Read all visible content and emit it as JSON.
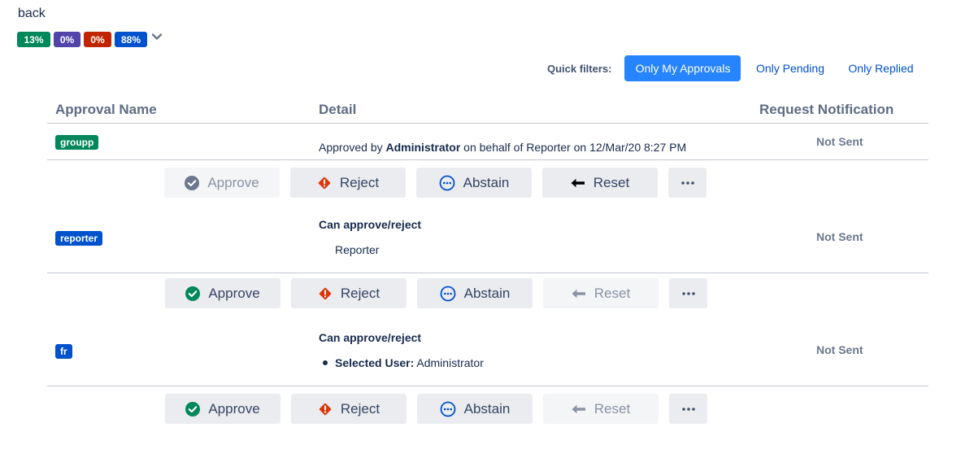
{
  "nav": {
    "back_label": "back"
  },
  "progress": {
    "badges": [
      {
        "label": "13%",
        "color": "#00875a"
      },
      {
        "label": "0%",
        "color": "#5243aa"
      },
      {
        "label": "0%",
        "color": "#bf2600"
      },
      {
        "label": "88%",
        "color": "#0052cc"
      }
    ],
    "expand_icon": "chevron-down-icon"
  },
  "quick_filters": {
    "label": "Quick filters:",
    "options": [
      {
        "label": "Only My Approvals",
        "active": true
      },
      {
        "label": "Only Pending",
        "active": false
      },
      {
        "label": "Only Replied",
        "active": false
      }
    ]
  },
  "table": {
    "headers": [
      "Approval Name",
      "Detail",
      "Request Notification"
    ],
    "rows": [
      {
        "name": "groupp",
        "name_color": "#00875a",
        "detail_prefix": "Approved by ",
        "detail_user": "Administrator",
        "detail_suffix": " on behalf of Reporter on 12/Mar/20 8:27 PM",
        "notification": "Not Sent"
      },
      {
        "name": "reporter",
        "name_color": "#0052cc",
        "detail_title": "Can approve/reject",
        "detail_sub": "Reporter",
        "notification": "Not Sent"
      },
      {
        "name": "fr",
        "name_color": "#0052cc",
        "detail_title": "Can approve/reject",
        "detail_bullet_label": "Selected User:",
        "detail_bullet_value": " Administrator",
        "notification": "Not Sent"
      }
    ]
  },
  "actions": {
    "approve_label": "Approve",
    "reject_label": "Reject",
    "abstain_label": "Abstain",
    "reset_label": "Reset",
    "more_label": "•••"
  },
  "colors": {
    "approve_enabled": "#00875a",
    "approve_disabled": "#6b778c",
    "reject": "#de350b",
    "abstain": "#0052cc",
    "reset_enabled": "#000000",
    "reset_disabled": "#8993a4"
  }
}
